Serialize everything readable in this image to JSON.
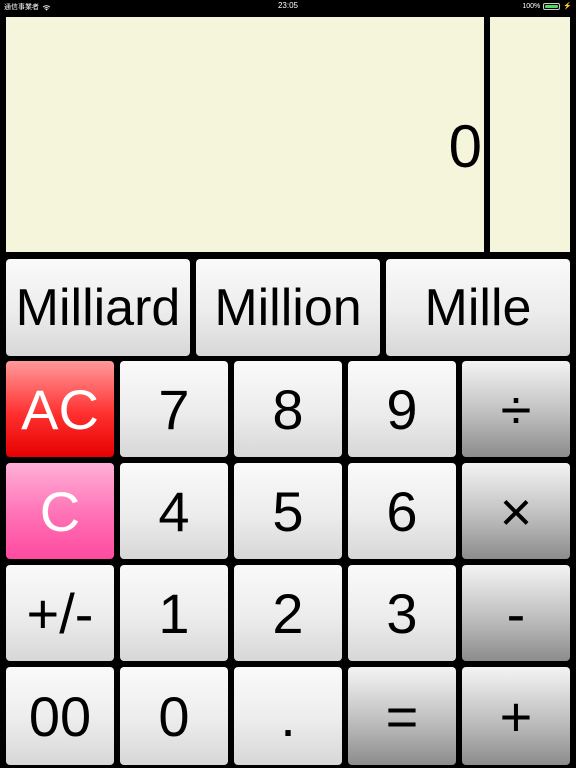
{
  "status_bar": {
    "carrier": "通信事業者",
    "time": "23:05",
    "battery_percent": "100%",
    "battery_level": 1.0
  },
  "display": {
    "value": "0"
  },
  "units": {
    "billion": "Milliard",
    "million": "Million",
    "thousand": "Mille"
  },
  "keys": {
    "ac": "AC",
    "c": "C",
    "sign": "+/-",
    "double_zero": "00",
    "zero": "0",
    "one": "1",
    "two": "2",
    "three": "3",
    "four": "4",
    "five": "5",
    "six": "6",
    "seven": "7",
    "eight": "8",
    "nine": "9",
    "decimal": ".",
    "equals": "=",
    "divide": "÷",
    "multiply": "×",
    "minus": "-",
    "plus": "+"
  },
  "colors": {
    "display_bg": "#f5f5dc",
    "ac_red": "#ff2a2a",
    "c_pink": "#ff6fb3"
  }
}
